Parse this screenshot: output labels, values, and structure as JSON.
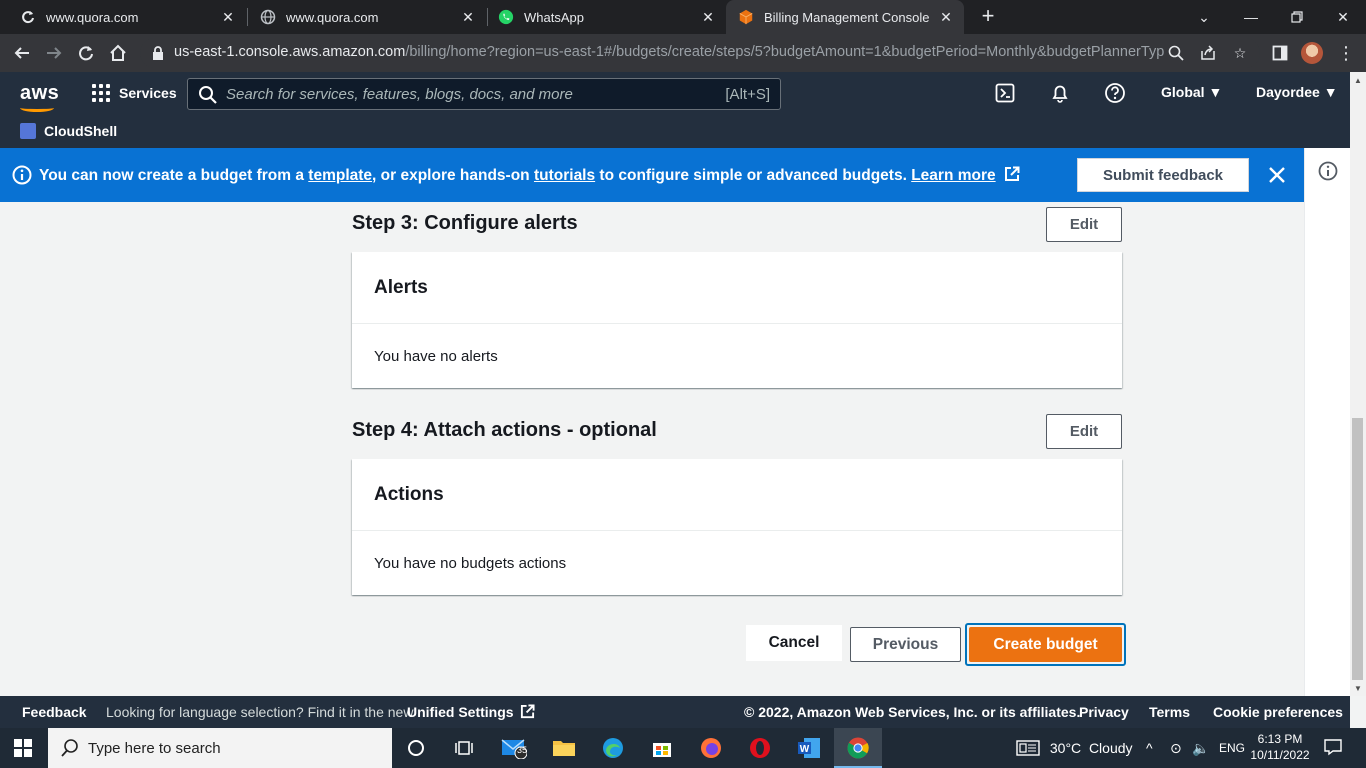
{
  "browser": {
    "tabs": [
      {
        "title": "www.quora.com",
        "icon": "quora-reload-icon"
      },
      {
        "title": "www.quora.com",
        "icon": "globe-icon"
      },
      {
        "title": "WhatsApp",
        "icon": "whatsapp-icon"
      },
      {
        "title": "Billing Management Console",
        "icon": "aws-box-icon"
      }
    ],
    "url_host": "us-east-1.console.aws.amazon.com",
    "url_path": "/billing/home?region=us-east-1#/budgets/create/steps/5?budgetAmount=1&budgetPeriod=Monthly&budgetPlannerTyp..."
  },
  "aws_header": {
    "logo": "aws",
    "services_label": "Services",
    "search_placeholder": "Search for services, features, blogs, docs, and more",
    "search_shortcut": "[Alt+S]",
    "region": "Global ▼",
    "account": "Dayordee ▼",
    "cloudshell_label": "CloudShell"
  },
  "banner": {
    "text_1": "You can now create a budget from a ",
    "link_template": "template",
    "text_2": ", or explore hands-on ",
    "link_tutorials": "tutorials",
    "text_3": " to configure simple or advanced budgets. ",
    "link_learn_more": "Learn more",
    "feedback_button": "Submit feedback"
  },
  "steps": {
    "step3": {
      "title": "Step 3: Configure alerts",
      "edit_label": "Edit",
      "panel_title": "Alerts",
      "panel_body": "You have no alerts"
    },
    "step4": {
      "title": "Step 4: Attach actions - optional",
      "edit_label": "Edit",
      "panel_title": "Actions",
      "panel_body": "You have no budgets actions"
    }
  },
  "actions": {
    "cancel": "Cancel",
    "previous": "Previous",
    "create": "Create budget"
  },
  "footer": {
    "feedback": "Feedback",
    "language_text": "Looking for language selection? Find it in the new",
    "unified_settings": "Unified Settings",
    "copyright": "© 2022, Amazon Web Services, Inc. or its affiliates.",
    "privacy": "Privacy",
    "terms": "Terms",
    "cookie": "Cookie preferences"
  },
  "taskbar": {
    "search_placeholder": "Type here to search",
    "mail_badge": "35",
    "weather": "30°C  Cloudy",
    "language": "ENG",
    "time": "6:13 PM",
    "date": "10/11/2022"
  },
  "colors": {
    "aws_navy": "#232f3e",
    "banner_blue": "#0972d3",
    "primary_orange": "#ec7211",
    "focus_blue": "#0073bb"
  }
}
